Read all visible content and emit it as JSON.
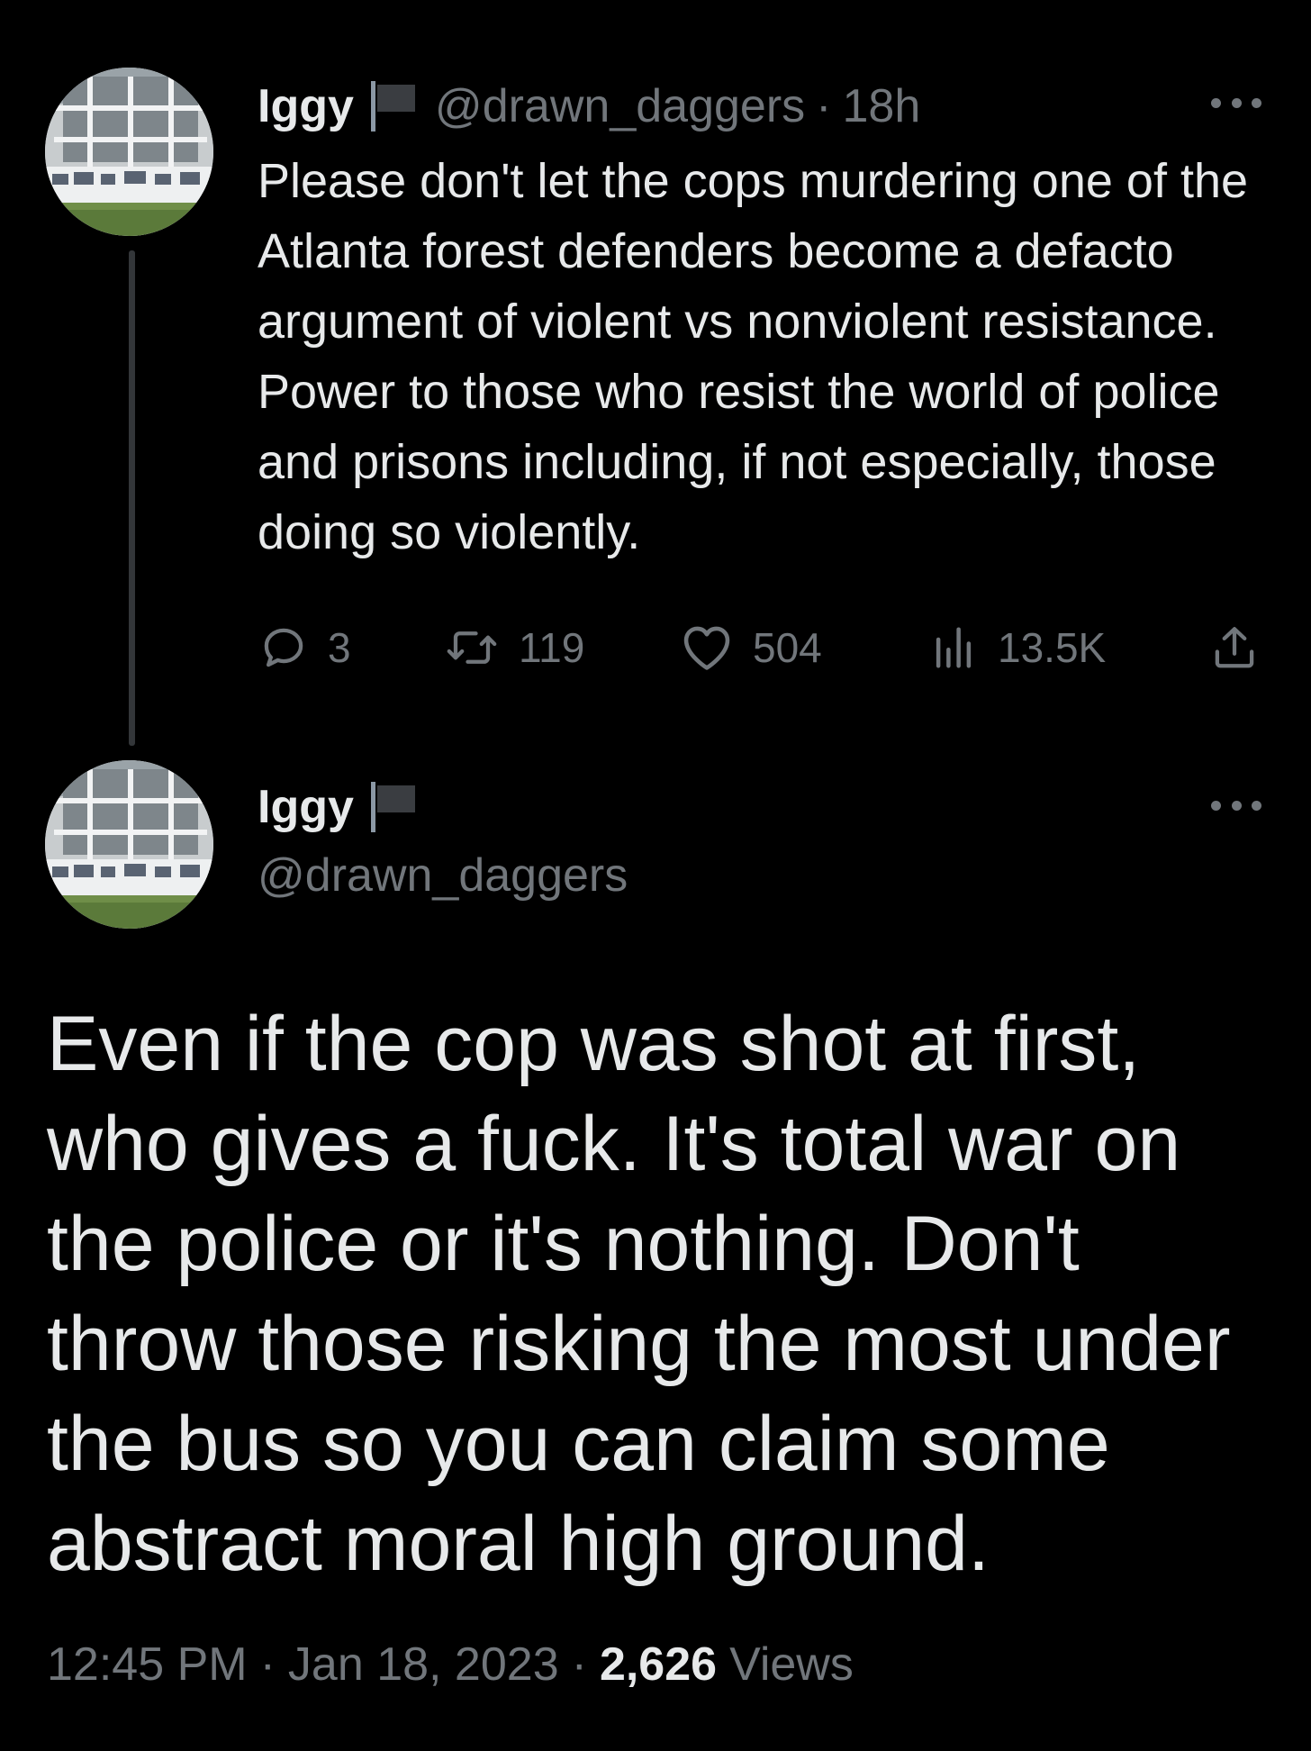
{
  "colors": {
    "background": "#000000",
    "primary_text": "#e7e9ea",
    "secondary_text": "#71767b",
    "thread_line": "#333639"
  },
  "first_tweet": {
    "avatar_icon": "profile-photo-graffiti-wall",
    "display_name": "Iggy",
    "flag_icon": "black-flag-icon",
    "handle": "@drawn_daggers",
    "separator": "·",
    "time_ago": "18h",
    "more_icon": "more-dots-icon",
    "text": "Please don't let the cops murdering one of the Atlanta forest defenders become a defacto argument of violent vs nonviolent resistance. Power to those who resist the world of police and prisons including, if not especially, those doing so violently.",
    "actions": {
      "replies": {
        "icon": "reply-bubble-icon",
        "count": "3"
      },
      "retweets": {
        "icon": "retweet-icon",
        "count": "119"
      },
      "likes": {
        "icon": "heart-icon",
        "count": "504"
      },
      "views": {
        "icon": "views-bar-chart-icon",
        "count": "13.5K"
      },
      "share": {
        "icon": "share-upload-icon"
      }
    }
  },
  "main_tweet": {
    "avatar_icon": "profile-photo-graffiti-wall",
    "display_name": "Iggy",
    "flag_icon": "black-flag-icon",
    "handle": "@drawn_daggers",
    "more_icon": "more-dots-icon",
    "text": "Even if the cop was shot at first, who gives a fuck. It's total war on the police or it's nothing. Don't throw those risking the most under the bus so you can claim some abstract moral high ground.",
    "time": "12:45 PM",
    "separator": "·",
    "date": "Jan 18, 2023",
    "views_count": "2,626",
    "views_label": "Views"
  }
}
